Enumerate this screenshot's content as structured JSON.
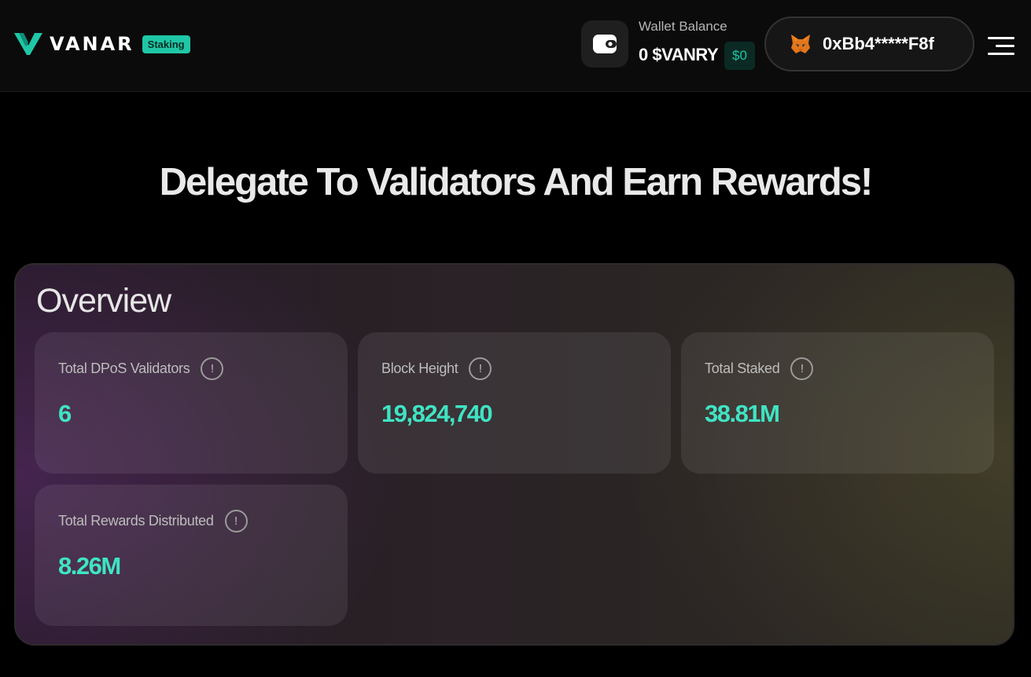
{
  "header": {
    "brand": "VANAR",
    "badge": "Staking",
    "wallet": {
      "label": "Wallet Balance",
      "amount": "0 $VANRY",
      "usd": "$0",
      "icon": "wallet-icon"
    },
    "address": "0xBb4*****F8f",
    "address_icon": "metamask-fox-icon",
    "menu_icon": "hamburger-menu-icon"
  },
  "hero": {
    "title": "Delegate To Validators And Earn Rewards!"
  },
  "overview": {
    "title": "Overview",
    "stats": [
      {
        "label": "Total DPoS Validators",
        "value": "6"
      },
      {
        "label": "Block Height",
        "value": "19,824,740"
      },
      {
        "label": "Total Staked",
        "value": "38.81M"
      },
      {
        "label": "Total Rewards Distributed",
        "value": "8.26M"
      }
    ],
    "info_glyph": "!"
  },
  "colors": {
    "accent": "#3fe4c4",
    "badge_bg": "#1fc7a6",
    "background": "#000000"
  }
}
